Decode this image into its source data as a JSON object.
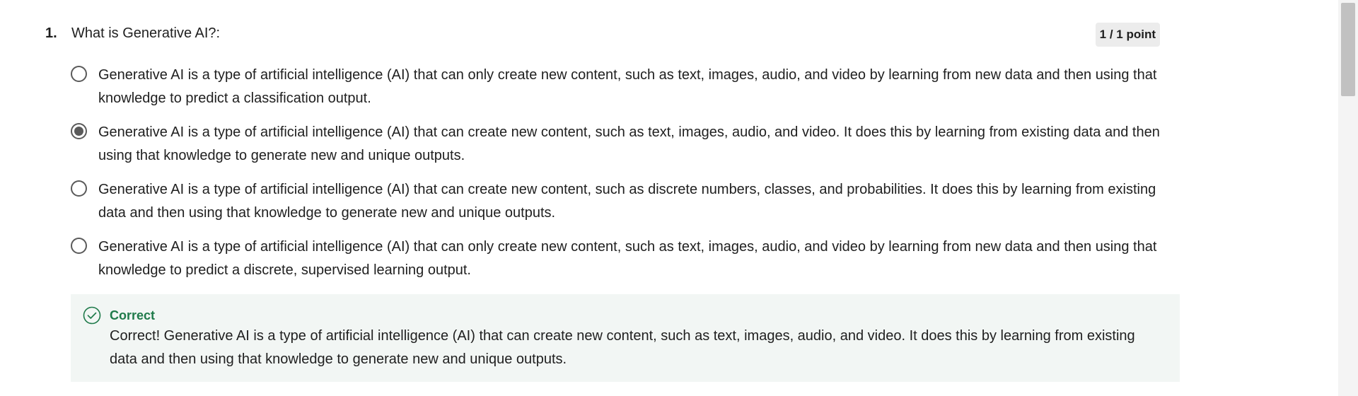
{
  "question": {
    "number": "1.",
    "text": "What is Generative AI?:",
    "points": "1 / 1 point"
  },
  "options": [
    {
      "label": "Generative AI is a type of artificial intelligence (AI) that can only create new content, such as text, images, audio, and video by learning from new data and then using that knowledge to predict a classification output.",
      "selected": false
    },
    {
      "label": "Generative AI is a type of artificial intelligence (AI) that can create new content, such as text, images, audio, and video. It does this by learning from existing data and then using that knowledge to generate new and unique outputs.",
      "selected": true
    },
    {
      "label": "Generative AI is a type of artificial intelligence (AI) that can create new content, such as discrete numbers, classes, and probabilities. It does this by learning from existing data and then using that knowledge to generate new and unique outputs.",
      "selected": false
    },
    {
      "label": "Generative AI is a type of artificial intelligence (AI) that can only create new content, such as text, images, audio, and video by learning from new data and then using that knowledge to predict a discrete, supervised learning output.",
      "selected": false
    }
  ],
  "feedback": {
    "icon": "check-circle-icon",
    "status": "Correct",
    "text": "Correct! Generative AI is a type of artificial intelligence (AI) that can create new content, such as text, images, audio, and video. It does this by learning from existing data and then using that knowledge to generate new and unique outputs.",
    "color": "#1f7a4a",
    "background": "#f2f6f4"
  }
}
